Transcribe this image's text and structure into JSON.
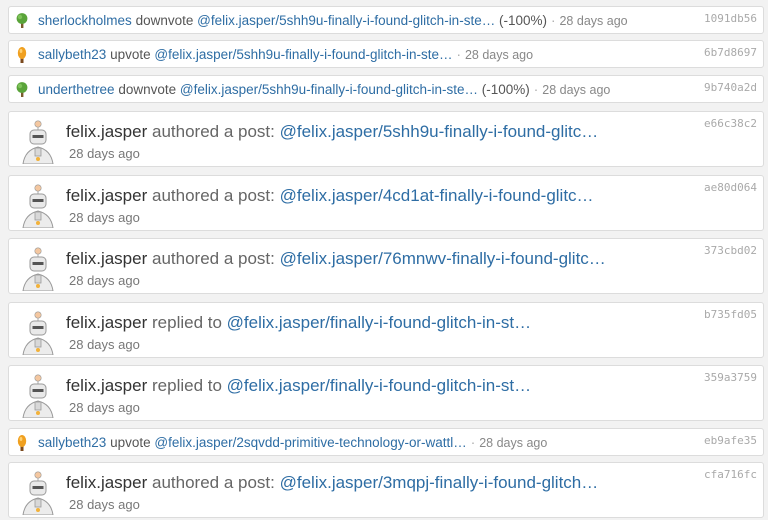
{
  "colors": {
    "link": "#2e6da4",
    "muted": "#888888",
    "hash": "#a9a9a9",
    "card_bg": "#ffffff",
    "page_bg": "#f2f2f2"
  },
  "separator": "·",
  "feed": [
    {
      "kind": "vote",
      "avatar": "tree-avatar-icon",
      "user": "sherlockholmes",
      "action": "downvote",
      "link": "@felix.jasper/5shh9u-finally-i-found-glitch-in-ste…",
      "extra": "(-100%)",
      "ago": "28 days ago",
      "hash": "1091db56"
    },
    {
      "kind": "vote",
      "avatar": "orange-avatar-icon",
      "user": "sallybeth23",
      "action": "upvote",
      "link": "@felix.jasper/5shh9u-finally-i-found-glitch-in-ste…",
      "extra": "",
      "ago": "28 days ago",
      "hash": "6b7d8697"
    },
    {
      "kind": "vote",
      "avatar": "tree-avatar-icon",
      "user": "underthetree",
      "action": "downvote",
      "link": "@felix.jasper/5shh9u-finally-i-found-glitch-in-ste…",
      "extra": "(-100%)",
      "ago": "28 days ago",
      "hash": "9b740a2d"
    },
    {
      "kind": "post",
      "avatar": "robot-avatar-icon",
      "user": "felix.jasper",
      "action": "authored a post:",
      "link": "@felix.jasper/5shh9u-finally-i-found-glitc…",
      "ago": "28 days ago",
      "hash": "e66c38c2"
    },
    {
      "kind": "post",
      "avatar": "robot-avatar-icon",
      "user": "felix.jasper",
      "action": "authored a post:",
      "link": "@felix.jasper/4cd1at-finally-i-found-glitc…",
      "ago": "28 days ago",
      "hash": "ae80d064"
    },
    {
      "kind": "post",
      "avatar": "robot-avatar-icon",
      "user": "felix.jasper",
      "action": "authored a post:",
      "link": "@felix.jasper/76mnwv-finally-i-found-glitc…",
      "ago": "28 days ago",
      "hash": "373cbd02"
    },
    {
      "kind": "post",
      "avatar": "robot-avatar-icon",
      "user": "felix.jasper",
      "action": "replied to",
      "link": "@felix.jasper/finally-i-found-glitch-in-st…",
      "ago": "28 days ago",
      "hash": "b735fd05"
    },
    {
      "kind": "post",
      "avatar": "robot-avatar-icon",
      "user": "felix.jasper",
      "action": "replied to",
      "link": "@felix.jasper/finally-i-found-glitch-in-st…",
      "ago": "28 days ago",
      "hash": "359a3759"
    },
    {
      "kind": "vote",
      "avatar": "orange-avatar-icon",
      "user": "sallybeth23",
      "action": "upvote",
      "link": "@felix.jasper/2sqvdd-primitive-technology-or-wattl…",
      "extra": "",
      "ago": "28 days ago",
      "hash": "eb9afe35"
    },
    {
      "kind": "post",
      "avatar": "robot-avatar-icon",
      "user": "felix.jasper",
      "action": "authored a post:",
      "link": "@felix.jasper/3mqpj-finally-i-found-glitch…",
      "ago": "28 days ago",
      "hash": "cfa716fc"
    }
  ]
}
